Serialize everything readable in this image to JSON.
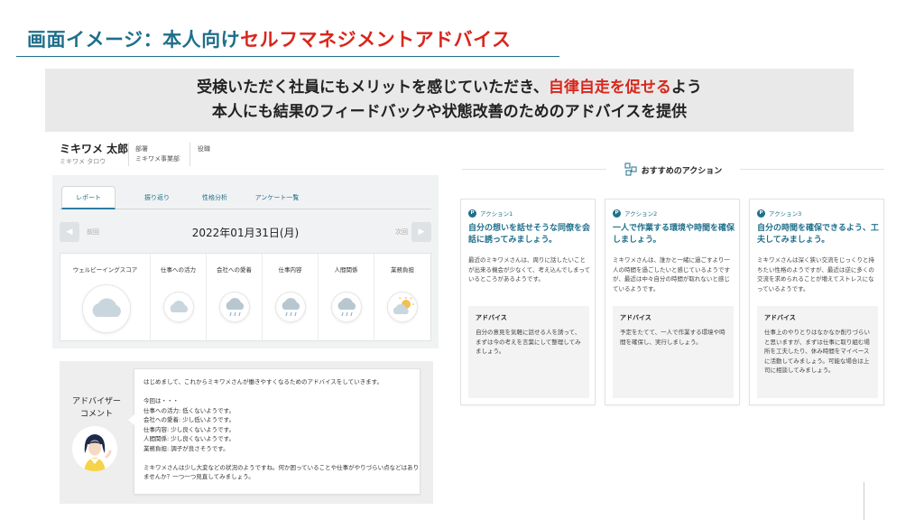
{
  "slide": {
    "title_prefix": "画面イメージ：本人向け",
    "title_highlight": "セルフマネジメントアドバイス",
    "banner_line1_pre": "受検いただく社員にもメリットを感じていただき、",
    "banner_line1_red": "自律自走を促せる",
    "banner_line1_post": "よう",
    "banner_line2": "本人にも結果のフィードバックや状態改善のためのアドバイスを提供"
  },
  "profile": {
    "name": "ミキワメ 太郎",
    "kana": "ミキワメ タロウ",
    "dept_label": "部署",
    "dept_value": "ミキワメ事業部",
    "role_label": "役職",
    "role_value": ""
  },
  "tabs": [
    "レポート",
    "振り返り",
    "性格分析",
    "アンケート一覧"
  ],
  "datebar": {
    "prev_label": "前回",
    "next_label": "次回",
    "date": "2022年01月31日(月)"
  },
  "scores": [
    {
      "label": "ウェルビーイングスコア",
      "weather": "cloudy"
    },
    {
      "label": "仕事への活力",
      "weather": "cloudy"
    },
    {
      "label": "会社への愛着",
      "weather": "rain"
    },
    {
      "label": "仕事内容",
      "weather": "rain"
    },
    {
      "label": "人間関係",
      "weather": "rain"
    },
    {
      "label": "業務負担",
      "weather": "sunny-cloudy"
    }
  ],
  "advisor": {
    "label_line1": "アドバイザー",
    "label_line2": "コメント",
    "lines": [
      "はじめまして、これからミキワメさんが働きやすくなるためのアドバイスをしていきます。",
      "",
      "今回は・・・",
      "仕事への活力: 低くないようです。",
      "会社への愛着: 少し低いようです。",
      "仕事内容: 少し良くないようです。",
      "人間関係: 少し良くないようです。",
      "業務負担: 調子が良さそうです。",
      "",
      "ミキワメさんは少し大変などの状況のようですね。何か困っていることや仕事がやりづらい点などはあり",
      "ませんか？一つ一つ見直してみましょう。"
    ]
  },
  "actions": {
    "heading": "おすすめのアクション",
    "cards": [
      {
        "tag": "アクション1",
        "title": "自分の想いを話せそうな同僚を会話に誘ってみましょう。",
        "body": "最近のミキワメさんは、周りに話したいことが出来る機会が少なくて、考え込んでしまっているところがあるようです。",
        "advice_label": "アドバイス",
        "advice": "自分の意見を気軽に話せる人を誘って、まずは今の考えを言葉にして整理してみましょう。"
      },
      {
        "tag": "アクション2",
        "title": "一人で作業する環境や時間を確保しましょう。",
        "body": "ミキワメさんは、誰かと一緒に過ごすより一人の時間を過ごしたいと感じているようですが、最近は中々自分の時間が取れないと感じているようです。",
        "advice_label": "アドバイス",
        "advice": "予定をたてて、一人で作業する環境や時間を確保し、実行しましょう。"
      },
      {
        "tag": "アクション3",
        "title": "自分の時間を確保できるよう、工夫してみましょう。",
        "body": "ミキワメさんは深く狭い交流をじっくりと持ちたい性格のようですが、最近は逆に多くの交流を求められることが増えてストレスになっているようです。",
        "advice_label": "アドバイス",
        "advice": "仕事上のやりとりはなかなか削りづらいと思いますが、まずは仕事に取り組む場所を工夫したり、休み時間をマイペースに活動してみましょう。可能な場合は上司に相談してみましょう。"
      }
    ]
  }
}
